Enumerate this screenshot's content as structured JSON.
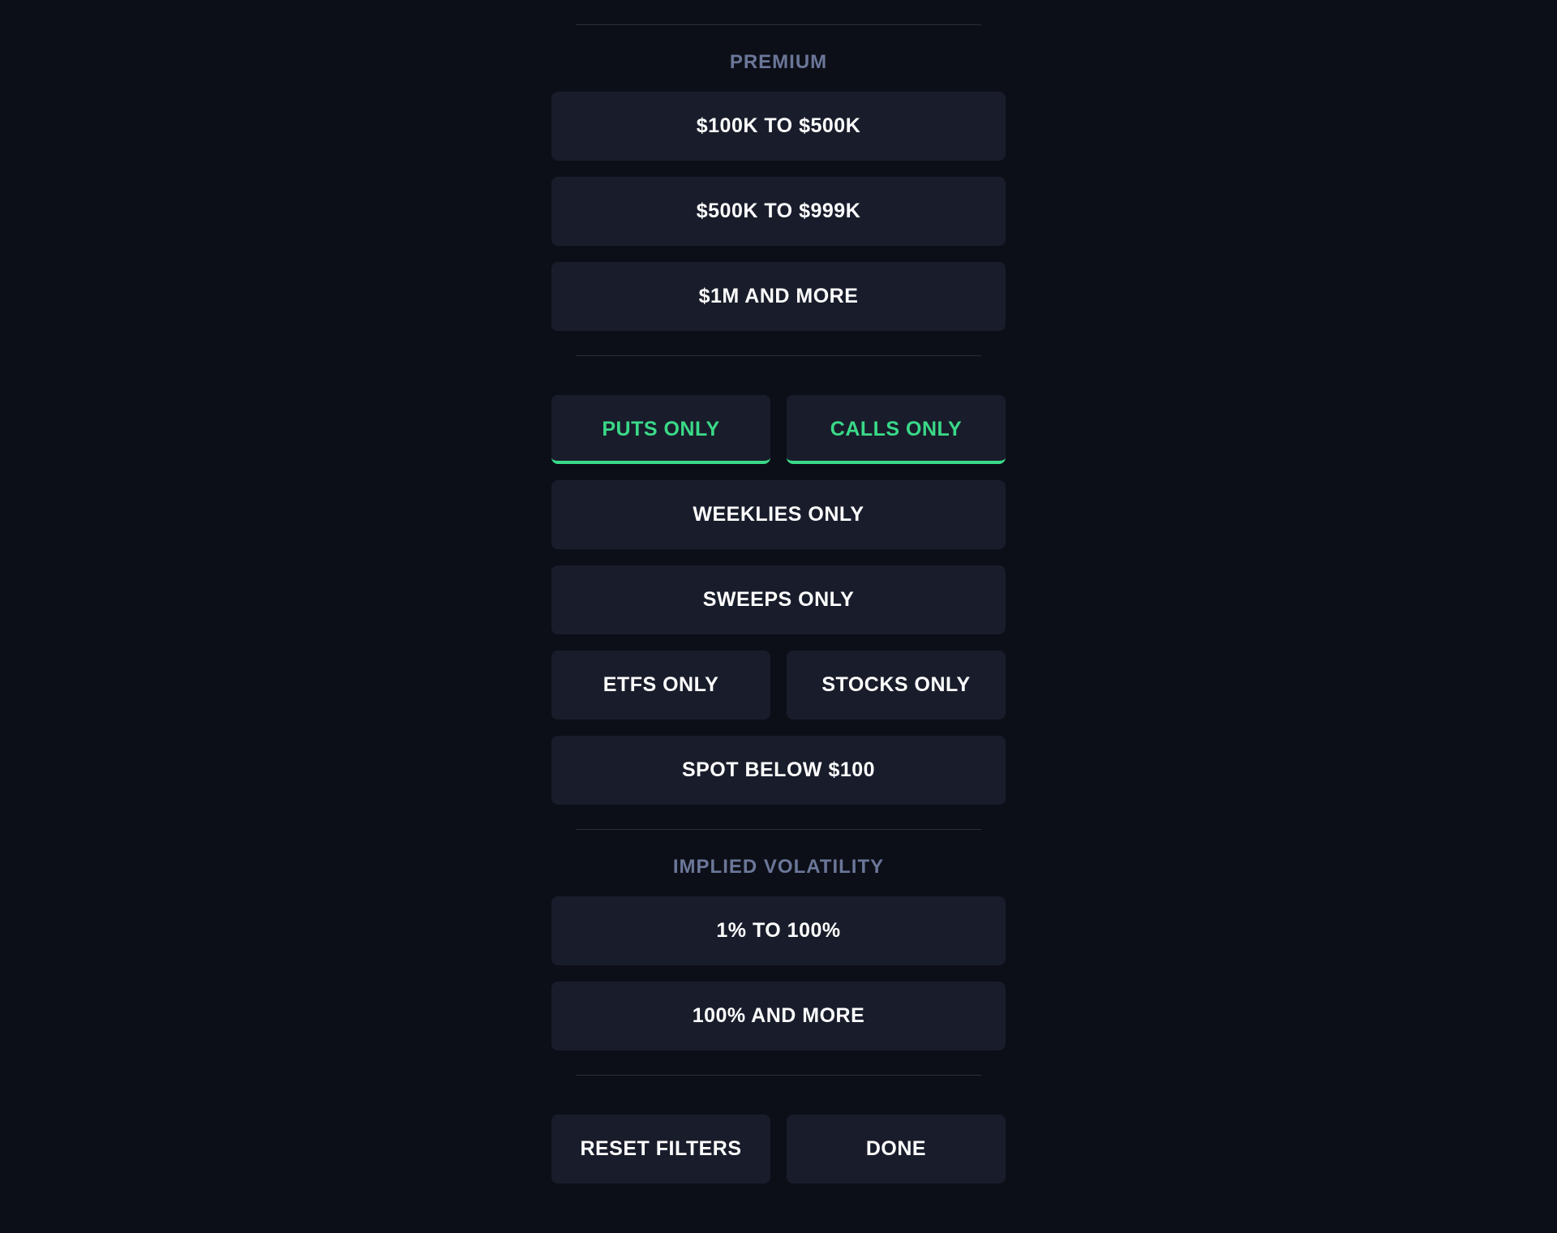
{
  "sections": {
    "premium": {
      "label": "PREMIUM",
      "options": [
        "$100K TO $500K",
        "$500K TO $999K",
        "$1M AND MORE"
      ]
    },
    "filters": {
      "puts": "PUTS ONLY",
      "calls": "CALLS ONLY",
      "weeklies": "WEEKLIES ONLY",
      "sweeps": "SWEEPS ONLY",
      "etfs": "ETFS ONLY",
      "stocks": "STOCKS ONLY",
      "spot": "SPOT BELOW $100"
    },
    "iv": {
      "label": "IMPLIED VOLATILITY",
      "options": [
        "1% TO 100%",
        "100% AND MORE"
      ]
    },
    "actions": {
      "reset": "RESET FILTERS",
      "done": "DONE"
    }
  }
}
